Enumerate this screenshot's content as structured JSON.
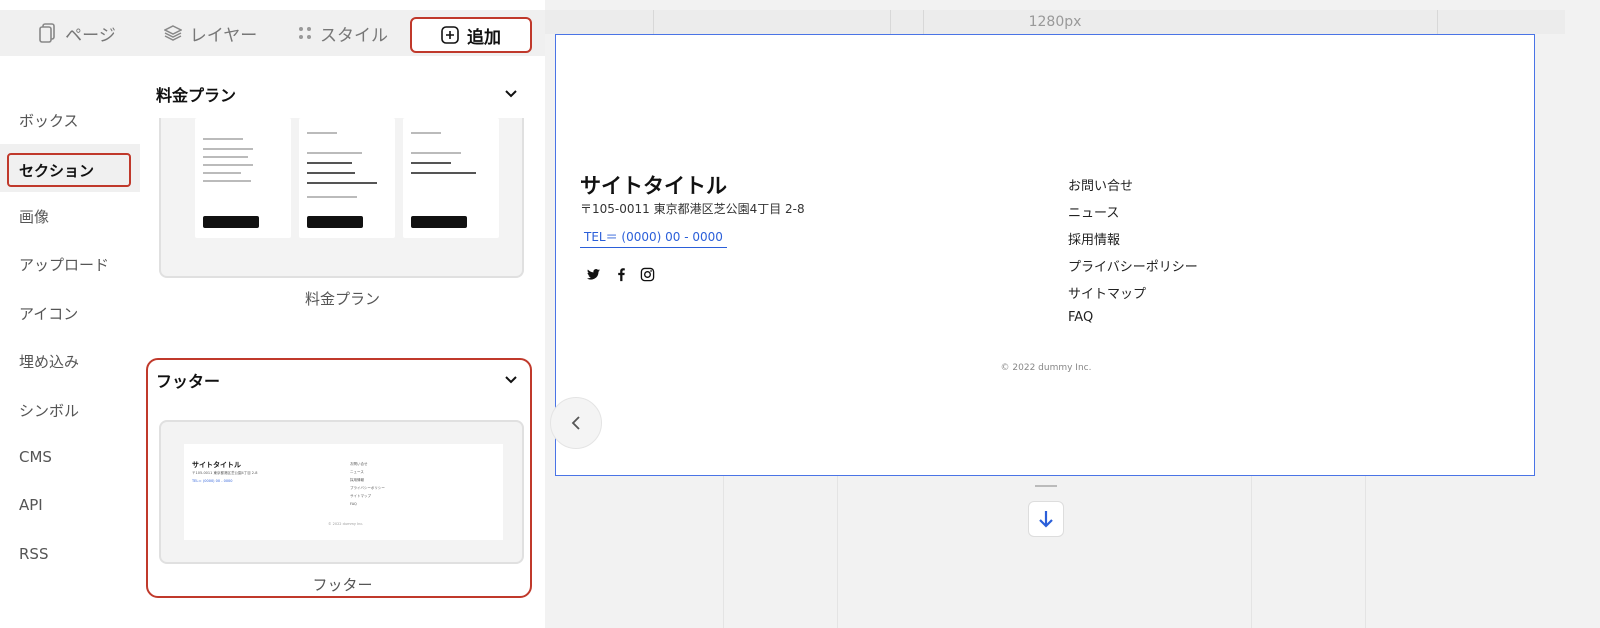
{
  "tabs": [
    {
      "label": "ページ",
      "icon": "page-icon"
    },
    {
      "label": "レイヤー",
      "icon": "layers-icon"
    },
    {
      "label": "スタイル",
      "icon": "style-icon"
    },
    {
      "label": "追加",
      "icon": "add-box-icon"
    }
  ],
  "categories": [
    "ボックス",
    "セクション",
    "画像",
    "アップロード",
    "アイコン",
    "埋め込み",
    "シンボル",
    "CMS",
    "API",
    "RSS"
  ],
  "sections": {
    "pricing": {
      "title": "料金プラン",
      "caption": "料金プラン"
    },
    "footer": {
      "title": "フッター",
      "caption": "フッター"
    }
  },
  "canvas": {
    "ruler_label": "1280px",
    "site_title": "サイトタイトル",
    "address": "〒105-0011 東京都港区芝公園4丁目 2-8",
    "tel": "TEL＝ (0000) 00 - 0000",
    "links": [
      "お問い合せ",
      "ニュース",
      "採用情報",
      "プライバシーポリシー",
      "サイトマップ",
      "FAQ"
    ],
    "copyright": "© 2022 dummy Inc."
  },
  "colors": {
    "highlight": "#c0392b",
    "accent": "#2b5fd9"
  }
}
